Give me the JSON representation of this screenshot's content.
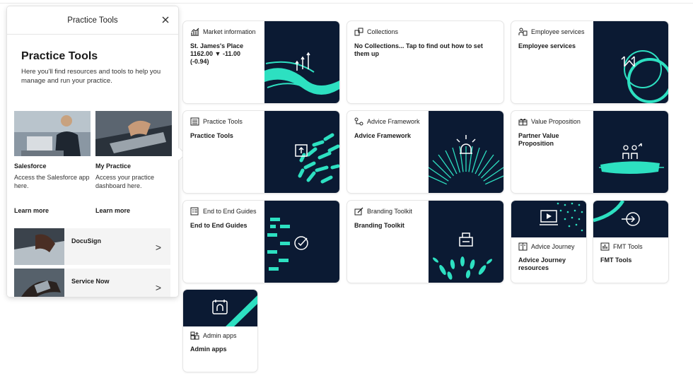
{
  "panel": {
    "header_title": "Practice Tools",
    "close_glyph": "×",
    "title": "Practice Tools",
    "description": "Here you'll find resources and tools to help you manage and run your practice.",
    "cards": [
      {
        "name": "Salesforce",
        "desc": "Access the Salesforce app here.",
        "link": "Learn more"
      },
      {
        "name": "My Practice",
        "desc": "Access your practice dashboard here.",
        "link": "Learn more"
      }
    ],
    "rows": [
      {
        "label": "DocuSign",
        "chevron": ">"
      },
      {
        "label": "Service Now",
        "chevron": ">"
      }
    ]
  },
  "tiles": {
    "market": {
      "header": "Market information",
      "title": "St. James's Place\n1162.00 ▼ -11.00\n(-0.94)",
      "icon": "chart-icon"
    },
    "collections": {
      "header": "Collections",
      "title": "No Collections... Tap to find out how to set them up",
      "icon": "collections-icon"
    },
    "employee": {
      "header": "Employee services",
      "title": "Employee services",
      "icon": "employee-icon"
    },
    "practice": {
      "header": "Practice Tools",
      "title": "Practice Tools",
      "icon": "list-icon"
    },
    "advice_framework": {
      "header": "Advice Framework",
      "title": "Advice Framework",
      "icon": "flow-icon"
    },
    "value_prop": {
      "header": "Value Proposition",
      "title": "Partner Value Proposition",
      "icon": "gift-icon"
    },
    "end_guides": {
      "header": "End to End Guides",
      "title": "End to End Guides",
      "icon": "checklist-icon"
    },
    "branding": {
      "header": "Branding Toolkit",
      "title": "Branding Toolkit",
      "icon": "brush-icon"
    },
    "advice_journey": {
      "header": "Advice Journey",
      "title": "Advice Journey resources",
      "icon": "book-icon"
    },
    "fmt": {
      "header": "FMT Tools",
      "title": "FMT Tools",
      "icon": "fmt-icon"
    },
    "admin": {
      "header": "Admin apps",
      "title": "Admin apps",
      "icon": "apps-icon"
    }
  },
  "colors": {
    "navy": "#0b1a33",
    "teal": "#2de0c1"
  }
}
